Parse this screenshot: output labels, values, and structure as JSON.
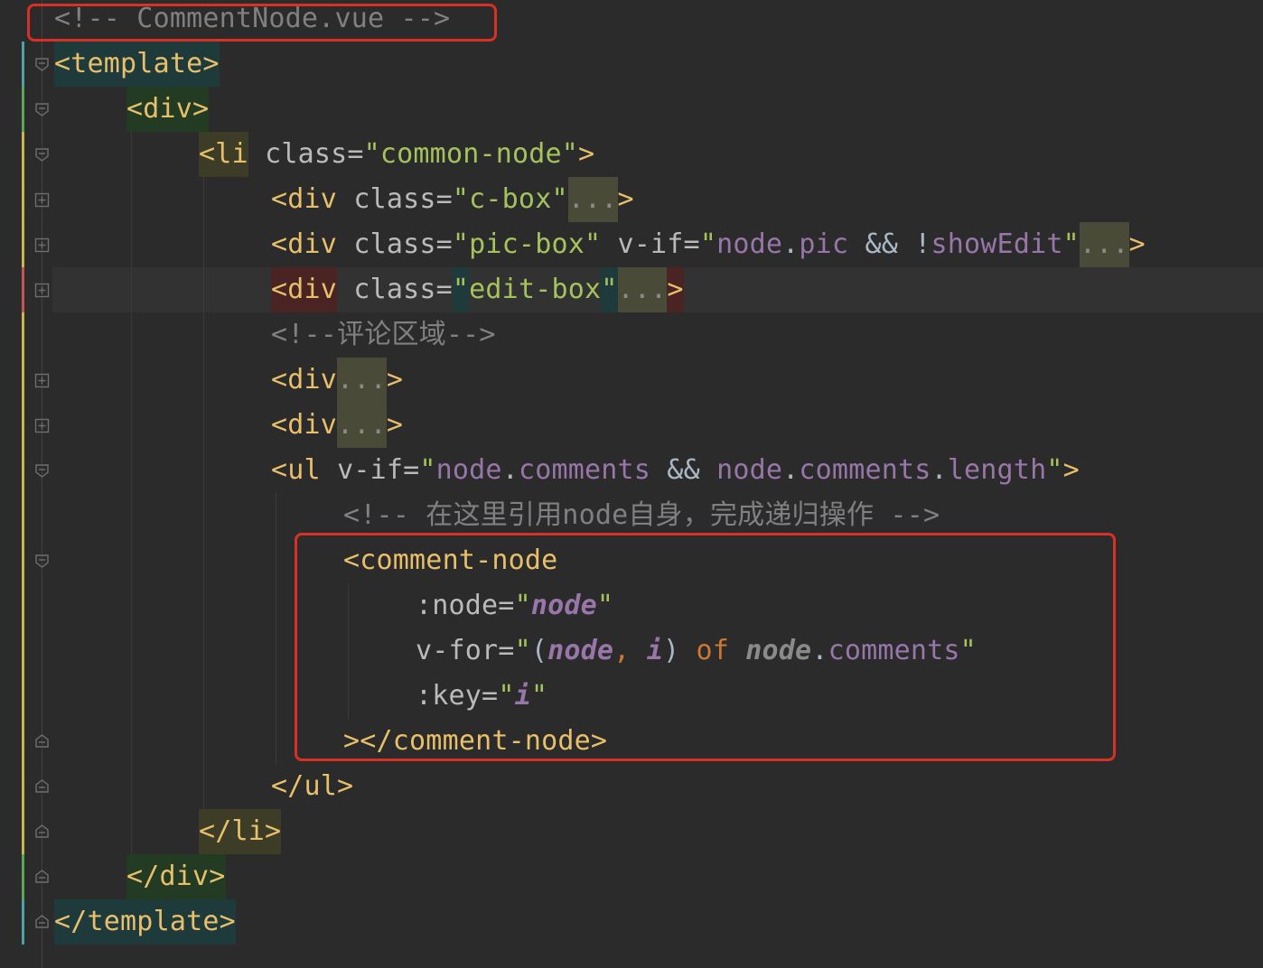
{
  "editor": {
    "file_comment": "<!-- CommentNode.vue -->",
    "lines": {
      "l2": {
        "open": "<template>"
      },
      "l3": {
        "open": "<div>"
      },
      "l4": {
        "lt": "<",
        "name": "li",
        "attr": "class=",
        "val": "\"common-node\"",
        "gt": ">"
      },
      "l5": {
        "open": "<div",
        "attr": "class=",
        "val": "\"c-box\"",
        "fold": "...",
        "gt": ">"
      },
      "l6": {
        "open": "<div",
        "attr": "class=",
        "val": "\"pic-box\"",
        "attr2": "v-if=",
        "q1": "\"",
        "p1": "node",
        "dot": ".",
        "p2": "pic",
        "op": " && !",
        "p3": "showEdit",
        "q2": "\"",
        "fold": "...",
        "gt": ">"
      },
      "l7": {
        "open": "<div",
        "attr": "class=",
        "q1": "\"",
        "val": "edit-box",
        "q2": "\"",
        "fold": "...",
        "gt": ">"
      },
      "l8": {
        "comment": "<!--评论区域-->"
      },
      "l9": {
        "open": "<div",
        "fold": "...",
        "gt": ">"
      },
      "l10": {
        "open": "<div",
        "fold": "...",
        "gt": ">"
      },
      "l11": {
        "open": "<ul",
        "attr": "v-if=",
        "q1": "\"",
        "p1": "node",
        "d1": ".",
        "p2": "comments",
        "op": " && ",
        "p3": "node",
        "d2": ".",
        "p4": "comments",
        "d3": ".",
        "p5": "length",
        "q2": "\"",
        "gt": ">"
      },
      "l12": {
        "comment": "<!-- 在这里引用node自身，完成递归操作 -->"
      },
      "l13": {
        "open": "<comment-node"
      },
      "l14": {
        "attr": ":node=",
        "q1": "\"",
        "v": "node",
        "q2": "\""
      },
      "l15": {
        "attr": "v-for=",
        "q1": "\"",
        "paren1": "(",
        "v1": "node",
        "comma": ", ",
        "v2": "i",
        "paren2": ")",
        "kw": " of ",
        "v3": "node",
        "dot": ".",
        "p": "comments",
        "q2": "\""
      },
      "l16": {
        "attr": ":key=",
        "q1": "\"",
        "v": "i",
        "q2": "\""
      },
      "l17": {
        "close": "></comment-node>"
      },
      "l18": {
        "close": "</ul>"
      },
      "l19": {
        "close": "</li>"
      },
      "l20": {
        "close": "</div>"
      },
      "l21": {
        "close": "</template>"
      }
    }
  },
  "colors": {
    "background": "#2b2b2b",
    "tag": "#e8bf6a",
    "attribute": "#bababa",
    "string": "#a5c25c",
    "comment": "#808080",
    "property": "#9876aa",
    "keyword": "#cc7832",
    "annotation_box": "#d93025"
  },
  "icons": [
    "fold-collapse-icon",
    "fold-expand-icon",
    "fold-end-icon"
  ]
}
